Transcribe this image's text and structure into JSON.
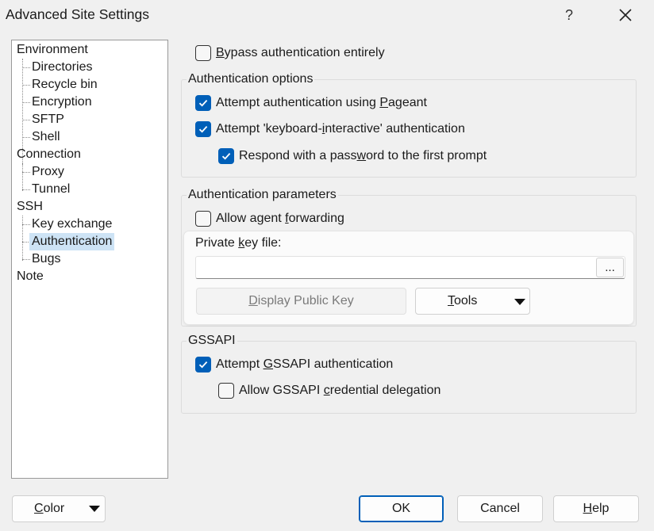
{
  "window": {
    "title": "Advanced Site Settings",
    "help_glyph": "?"
  },
  "tree": {
    "items": [
      {
        "label": "Environment",
        "level": 0
      },
      {
        "label": "Directories",
        "level": 1
      },
      {
        "label": "Recycle bin",
        "level": 1
      },
      {
        "label": "Encryption",
        "level": 1
      },
      {
        "label": "SFTP",
        "level": 1
      },
      {
        "label": "Shell",
        "level": 1
      },
      {
        "label": "Connection",
        "level": 0
      },
      {
        "label": "Proxy",
        "level": 1
      },
      {
        "label": "Tunnel",
        "level": 1
      },
      {
        "label": "SSH",
        "level": 0
      },
      {
        "label": "Key exchange",
        "level": 1
      },
      {
        "label": "Authentication",
        "level": 1,
        "selected": true
      },
      {
        "label": "Bugs",
        "level": 1
      },
      {
        "label": "Note",
        "level": 0
      }
    ]
  },
  "bypass": {
    "checked": false,
    "label_pre": "",
    "label_u": "B",
    "label_post": "ypass authentication entirely"
  },
  "auth_options": {
    "title": "Authentication options",
    "pageant": {
      "checked": true,
      "label_pre": "Attempt authentication using ",
      "label_u": "P",
      "label_post": "ageant"
    },
    "keyboard_interactive": {
      "checked": true,
      "label_pre": "Attempt 'keyboard-",
      "label_u": "i",
      "label_post": "nteractive' authentication"
    },
    "respond_password": {
      "checked": true,
      "label_pre": "Respond with a pass",
      "label_u": "w",
      "label_post": "ord to the first prompt"
    }
  },
  "auth_params": {
    "title": "Authentication parameters",
    "agent_forwarding": {
      "checked": false,
      "label_pre": "Allow agent ",
      "label_u": "f",
      "label_post": "orwarding"
    },
    "private_key": {
      "label_pre": "Private ",
      "label_u": "k",
      "label_post": "ey file:",
      "value": "",
      "browse_label": "..."
    },
    "display_public_key": {
      "label_pre": "",
      "label_u": "D",
      "label_post": "isplay Public Key"
    },
    "tools": {
      "label_pre": "",
      "label_u": "T",
      "label_post": "ools"
    }
  },
  "gssapi": {
    "title": "GSSAPI",
    "attempt": {
      "checked": true,
      "label_pre": "Attempt ",
      "label_u": "G",
      "label_post": "SSAPI authentication"
    },
    "delegation": {
      "checked": false,
      "label_pre": "Allow GSSAPI ",
      "label_u": "c",
      "label_post": "redential delegation"
    }
  },
  "footer": {
    "color": {
      "label_pre": "",
      "label_u": "C",
      "label_post": "olor"
    },
    "ok": "OK",
    "cancel": "Cancel",
    "help": {
      "label_pre": "",
      "label_u": "H",
      "label_post": "elp"
    }
  },
  "colors": {
    "accent": "#005fb8",
    "selection": "#cde3f5",
    "background": "#f0f0f0"
  }
}
